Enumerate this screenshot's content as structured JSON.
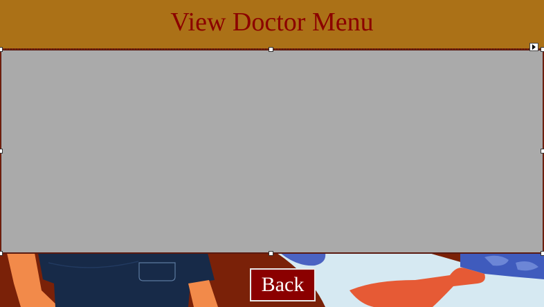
{
  "header": {
    "title": "View Doctor Menu"
  },
  "grid": {
    "fill_color": "#aaaaaa",
    "selected": true
  },
  "footer": {
    "back_label": "Back"
  },
  "colors": {
    "header_bg": "#ab7117",
    "title_text": "#8b0000",
    "button_bg": "#8b0000",
    "page_bg": "#7a2108"
  },
  "icons": {
    "smart_tag": "triangle-right-icon"
  }
}
